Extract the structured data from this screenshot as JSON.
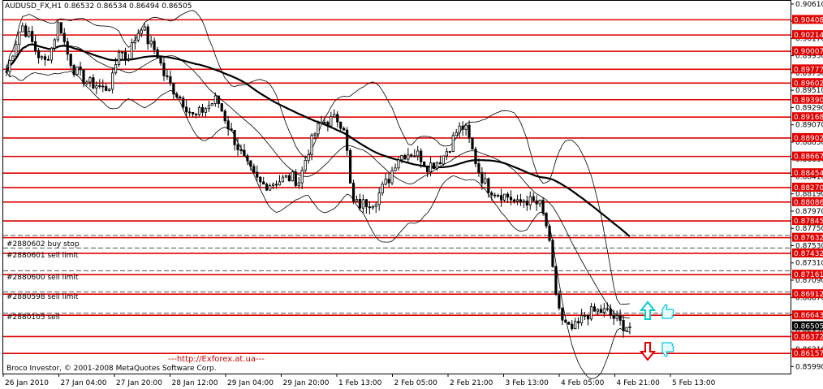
{
  "header": {
    "symbol": "AUDUSD_FX,H1",
    "ohlc": "0.86532 0.86534 0.86494 0.86505"
  },
  "copyright": "Broco Investor, © 2001-2008 MetaQuotes Software Corp.",
  "site_url": "---http://Exforex.at.ua---",
  "order_labels": [
    {
      "text": "#2880602 buy stop",
      "price": 0.8766
    },
    {
      "text": "#2880601 sell limit",
      "price": 0.875
    },
    {
      "text": "#2880600 sell limit",
      "price": 0.8721
    },
    {
      "text": "#2880598 sell limit",
      "price": 0.8694
    },
    {
      "text": "#2880105 sell",
      "price": 0.8667
    }
  ],
  "colors": {
    "level_line": "#e00000",
    "order_line": "#505050",
    "candle": "#000000",
    "ma": "#000000",
    "up_arrow": "#00d0d0",
    "down_arrow": "#e00000",
    "hand_icon": "#00c8e0",
    "price_tag_bg": "#e00000",
    "current_tag_bg": "#000000"
  },
  "icons": [
    "up-arrow-icon",
    "down-arrow-icon",
    "thumbs-up-hand-icon",
    "thumbs-down-hand-icon"
  ],
  "chart_data": {
    "type": "candlestick",
    "title": "AUDUSD_FX,H1",
    "ylim": [
      0.859,
      0.9065
    ],
    "y_ticks": [
      "0.90610",
      "0.90390",
      "0.90170",
      "0.89950",
      "0.89730",
      "0.89510",
      "0.89290",
      "0.89070",
      "0.88850",
      "0.88630",
      "0.88410",
      "0.88190",
      "0.87970",
      "0.87750",
      "0.87530",
      "0.87310",
      "0.87090",
      "0.86870",
      "0.86650",
      "0.86430",
      "0.86210",
      "0.85990"
    ],
    "current_price": {
      "label": "0.86505",
      "value": 0.86505
    },
    "x_labels": [
      "26 Jan 2010",
      "27 Jan 04:00",
      "27 Jan 20:00",
      "28 Jan 12:00",
      "29 Jan 04:00",
      "29 Jan 20:00",
      "1 Feb 13:00",
      "2 Feb 05:00",
      "2 Feb 21:00",
      "3 Feb 13:00",
      "4 Feb 05:00",
      "4 Feb 21:00",
      "5 Feb 13:00"
    ],
    "levels": [
      {
        "label": "0.90408",
        "value": 0.90408
      },
      {
        "label": "0.90214",
        "value": 0.90214
      },
      {
        "label": "0.90007",
        "value": 0.90007
      },
      {
        "label": "0.89777",
        "value": 0.89777
      },
      {
        "label": "0.89602",
        "value": 0.89602
      },
      {
        "label": "0.89390",
        "value": 0.8939
      },
      {
        "label": "0.89168",
        "value": 0.89168
      },
      {
        "label": "0.88902",
        "value": 0.88902
      },
      {
        "label": "0.88667",
        "value": 0.88667
      },
      {
        "label": "0.88454",
        "value": 0.88454
      },
      {
        "label": "0.88270",
        "value": 0.8827
      },
      {
        "label": "0.88086",
        "value": 0.88086
      },
      {
        "label": "0.87845",
        "value": 0.87845
      },
      {
        "label": "0.87632",
        "value": 0.87632
      },
      {
        "label": "0.87432",
        "value": 0.87432
      },
      {
        "label": "0.87161",
        "value": 0.87161
      },
      {
        "label": "0.86912",
        "value": 0.86912
      },
      {
        "label": "0.86643",
        "value": 0.86643
      },
      {
        "label": "0.86372",
        "value": 0.86372
      },
      {
        "label": "0.86157",
        "value": 0.86157
      }
    ],
    "close_path": [
      0.8975,
      0.9005,
      0.9035,
      0.902,
      0.9,
      0.8985,
      0.9005,
      0.904,
      0.9,
      0.8978,
      0.8968,
      0.896,
      0.8958,
      0.8952,
      0.896,
      0.9005,
      0.899,
      0.9015,
      0.9035,
      0.901,
      0.9,
      0.897,
      0.8955,
      0.8943,
      0.893,
      0.8915,
      0.8925,
      0.8932,
      0.894,
      0.8918,
      0.8895,
      0.8875,
      0.8855,
      0.884,
      0.883,
      0.8832,
      0.8835,
      0.8838,
      0.884,
      0.8835,
      0.887,
      0.8895,
      0.891,
      0.8912,
      0.8915,
      0.8905,
      0.8808,
      0.8805,
      0.8808,
      0.881,
      0.8825,
      0.884,
      0.8865,
      0.887,
      0.8872,
      0.8868,
      0.8855,
      0.8858,
      0.8865,
      0.888,
      0.89,
      0.8905,
      0.8875,
      0.8845,
      0.8828,
      0.8822,
      0.8818,
      0.8815,
      0.8805,
      0.8812,
      0.8808,
      0.8805,
      0.8775,
      0.87,
      0.8655,
      0.8645,
      0.865,
      0.8665,
      0.8668,
      0.867,
      0.8668,
      0.866,
      0.8652,
      0.865
    ]
  }
}
